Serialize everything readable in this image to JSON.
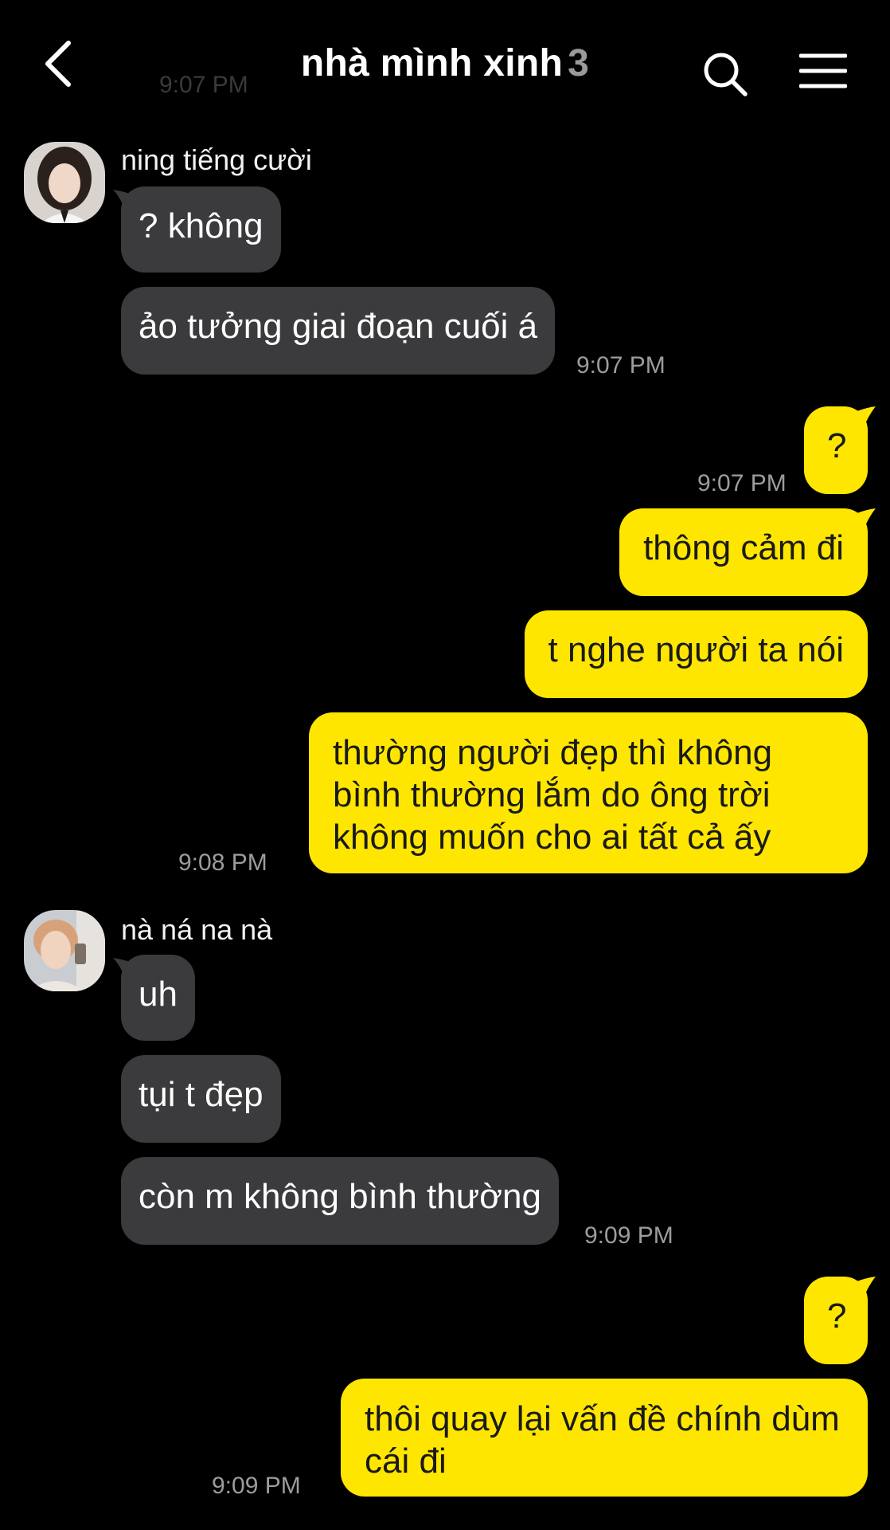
{
  "header": {
    "title": "nhà mình xinh",
    "member_count": "3",
    "ghost_time": "9:07 PM"
  },
  "messages": [
    {
      "sender": "ning tiếng cười",
      "text": "? không"
    },
    {
      "text": "ảo tưởng giai đoạn cuối á",
      "time": "9:07 PM"
    },
    {
      "text": "?",
      "time": "9:07 PM"
    },
    {
      "text": "thông cảm đi"
    },
    {
      "text": "t nghe người ta nói"
    },
    {
      "text": "thường người đẹp thì không bình thường lắm do ông trời không muốn cho ai tất cả ấy",
      "time": "9:08 PM"
    },
    {
      "sender": "nà ná na nà",
      "text": "uh"
    },
    {
      "text": "tụi t đẹp"
    },
    {
      "text": "còn m không bình thường",
      "time": "9:09 PM"
    },
    {
      "text": "?"
    },
    {
      "text": "thôi quay lại vấn đề chính dùm cái đi",
      "time": "9:09 PM"
    }
  ],
  "colors": {
    "background": "#000000",
    "incoming_bubble": "#3b3b3d",
    "outgoing_bubble": "#ffe600",
    "timestamp": "#9c9c9c"
  },
  "icons": [
    "chevron-left-icon",
    "search-icon",
    "hamburger-menu-icon",
    "avatar-ning",
    "avatar-na"
  ]
}
